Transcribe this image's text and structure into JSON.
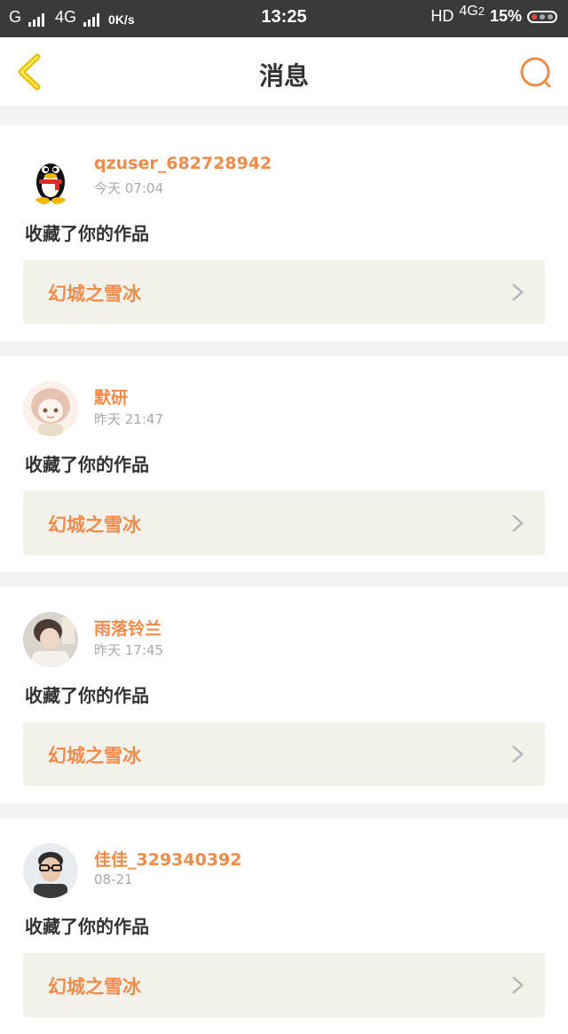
{
  "status_bar": {
    "carrier": "G",
    "network": "4G",
    "speed": "0K/s",
    "time": "13:25",
    "hd": "HD",
    "network2": "4G",
    "network2_sub": "2",
    "battery": "15%"
  },
  "nav": {
    "title": "消息",
    "back_icon": "chevron-left-icon",
    "search_icon": "search-icon",
    "accent_color": "#ef8b4b",
    "back_color": "#e8c000"
  },
  "messages": [
    {
      "user": "qzuser_682728942",
      "time": "今天 07:04",
      "action": "收藏了你的作品",
      "work": "幻城之雪冰",
      "avatar": "qq-penguin-avatar"
    },
    {
      "user": "默研",
      "time": "昨天 21:47",
      "action": "收藏了你的作品",
      "work": "幻城之雪冰",
      "avatar": "anime-girl-avatar"
    },
    {
      "user": "雨落铃兰",
      "time": "昨天 17:45",
      "action": "收藏了你的作品",
      "work": "幻城之雪冰",
      "avatar": "girl-photo-avatar"
    },
    {
      "user": "佳佳_329340392",
      "time": "08-21",
      "action": "收藏了你的作品",
      "work": "幻城之雪冰",
      "avatar": "man-glasses-avatar"
    }
  ]
}
